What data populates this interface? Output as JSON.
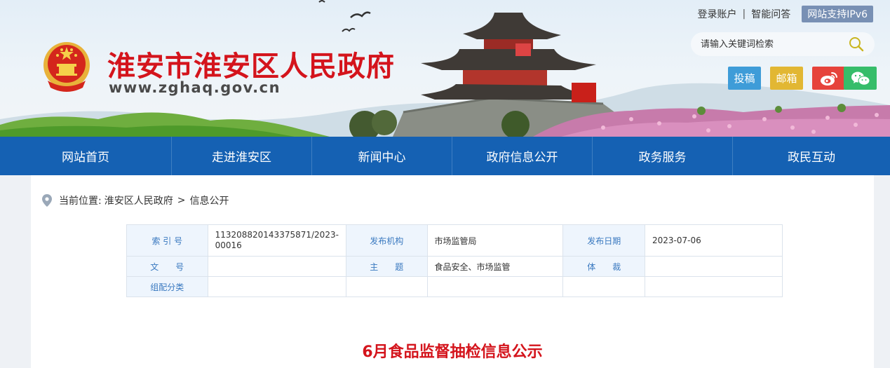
{
  "site": {
    "title": "淮安市淮安区人民政府",
    "url": "www.zghaq.gov.cn"
  },
  "top_links": {
    "login": "登录账户",
    "sep": "|",
    "qa": "智能问答",
    "ipv6": "网站支持IPv6"
  },
  "search": {
    "placeholder": "请输入关键词检索",
    "icon": "search-icon"
  },
  "quick_links": {
    "tougao": "投稿",
    "youxiang": "邮箱",
    "weibo_icon": "weibo-icon",
    "wechat_icon": "wechat-icon"
  },
  "nav": [
    "网站首页",
    "走进淮安区",
    "新闻中心",
    "政府信息公开",
    "政务服务",
    "政民互动"
  ],
  "breadcrumb": {
    "label": "当前位置:",
    "items": [
      "淮安区人民政府",
      "信息公开"
    ],
    "sep": ">"
  },
  "meta": {
    "suoyin_label": "索 引 号",
    "suoyin_value": "113208820143375871/2023-00016",
    "fabujigou_label": "发布机构",
    "fabujigou_value": "市场监管局",
    "faburiqi_label": "发布日期",
    "faburiqi_value": "2023-07-06",
    "wenhao_label": "文　　号",
    "wenhao_value": "",
    "zhuti_label": "主　　题",
    "zhuti_value": "食品安全、市场监管",
    "ticai_label": "体　　裁",
    "ticai_value": "",
    "zupei_label": "组配分类",
    "zupei_value": ""
  },
  "article": {
    "title": "6月食品监督抽检信息公示"
  },
  "colors": {
    "brand_red": "#d4141c",
    "nav_blue": "#1561b3",
    "label_blue": "#3a79c0"
  }
}
